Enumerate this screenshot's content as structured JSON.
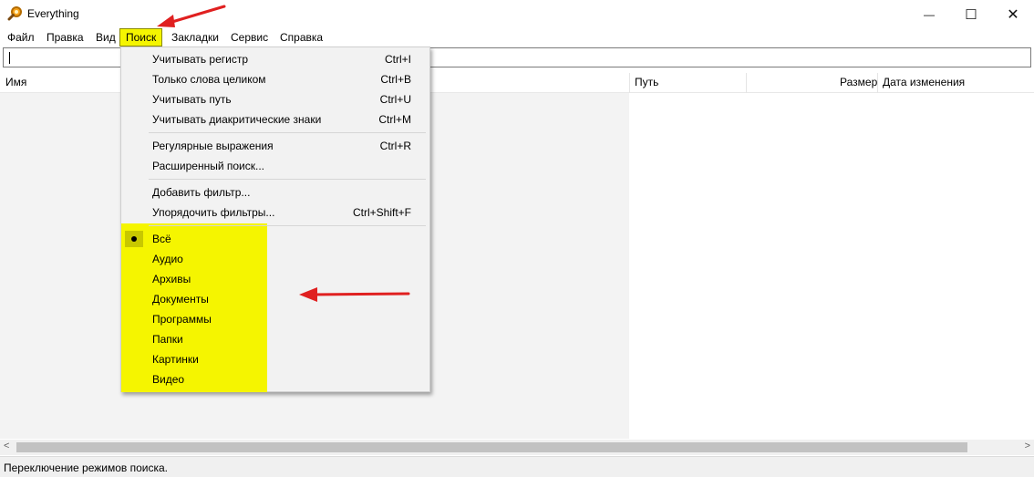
{
  "window": {
    "title": "Everything",
    "controls": {
      "minimize": "—",
      "maximize": "☐",
      "close": "✕"
    }
  },
  "menubar": {
    "items": [
      "Файл",
      "Правка",
      "Вид",
      "Поиск",
      "Закладки",
      "Сервис",
      "Справка"
    ],
    "active": "Поиск"
  },
  "search": {
    "value": ""
  },
  "columns": {
    "name": "Имя",
    "path": "Путь",
    "size": "Размер",
    "modified": "Дата изменения"
  },
  "dropdown": {
    "group1": [
      {
        "label": "Учитывать регистр",
        "shortcut": "Ctrl+I"
      },
      {
        "label": "Только слова целиком",
        "shortcut": "Ctrl+B"
      },
      {
        "label": "Учитывать путь",
        "shortcut": "Ctrl+U"
      },
      {
        "label": "Учитывать диакритические знаки",
        "shortcut": "Ctrl+M"
      }
    ],
    "group2": [
      {
        "label": "Регулярные выражения",
        "shortcut": "Ctrl+R"
      },
      {
        "label": "Расширенный поиск...",
        "shortcut": ""
      }
    ],
    "group3": [
      {
        "label": "Добавить фильтр...",
        "shortcut": ""
      },
      {
        "label": "Упорядочить фильтры...",
        "shortcut": "Ctrl+Shift+F"
      }
    ],
    "filters": [
      "Всё",
      "Аудио",
      "Архивы",
      "Документы",
      "Программы",
      "Папки",
      "Картинки",
      "Видео"
    ],
    "selected_filter": "Всё"
  },
  "statusbar": {
    "text": "Переключение режимов поиска."
  },
  "scrollbar": {
    "left_arrow": "<",
    "right_arrow": ">"
  },
  "colors": {
    "highlight": "#f5f500",
    "arrow": "#e02020",
    "results_bg": "#f3f3f3"
  }
}
